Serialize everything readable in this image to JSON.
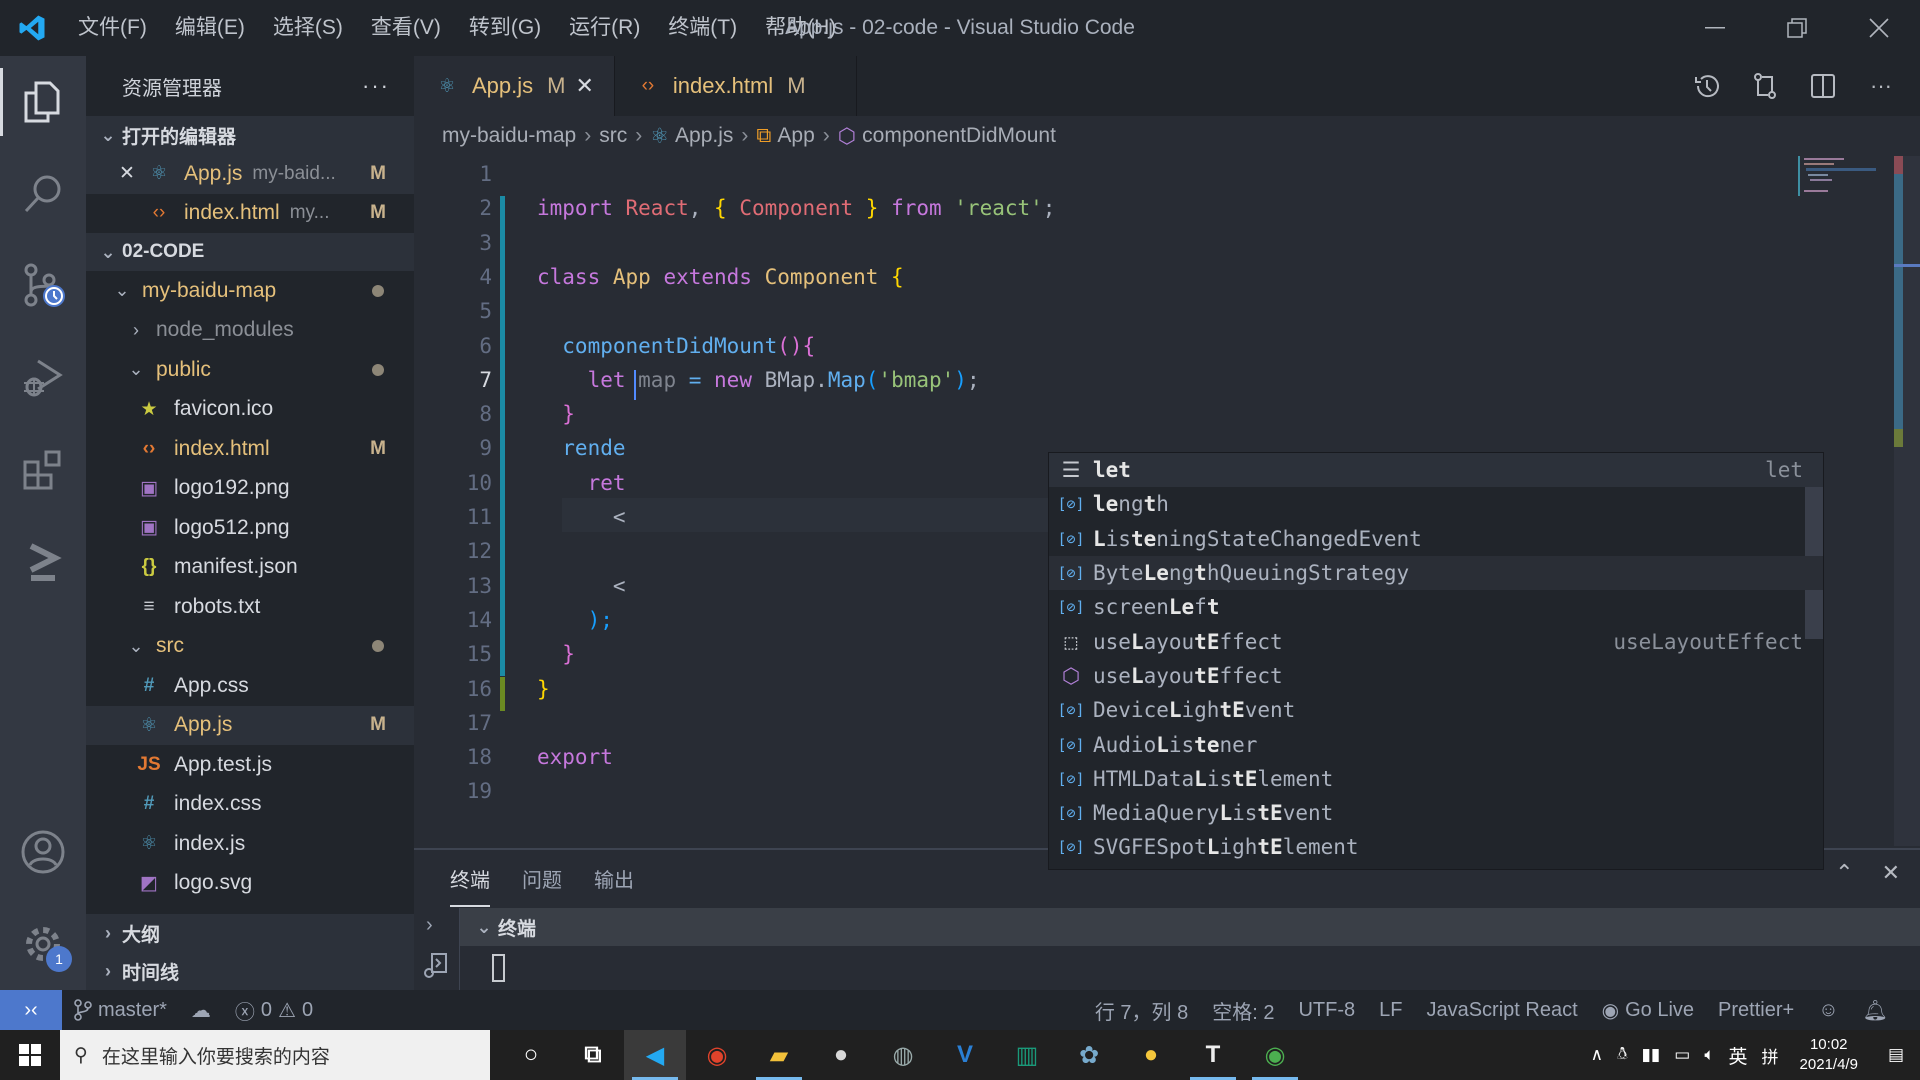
{
  "window": {
    "title": "App.js - 02-code - Visual Studio Code"
  },
  "menu": [
    "文件(F)",
    "编辑(E)",
    "选择(S)",
    "查看(V)",
    "转到(G)",
    "运行(R)",
    "终端(T)",
    "帮助(H)"
  ],
  "activity_bar": {
    "items": [
      "explorer",
      "search",
      "source-control",
      "run-debug",
      "extensions",
      "live-share"
    ],
    "settings_badge": "1"
  },
  "sidebar": {
    "title": "资源管理器",
    "open_editors": {
      "header": "打开的编辑器",
      "items": [
        {
          "name": "App.js",
          "desc": "my-baid...",
          "status": "M"
        },
        {
          "name": "index.html",
          "desc": "my...",
          "status": "M"
        }
      ]
    },
    "workspace": {
      "header": "02-CODE",
      "tree": [
        {
          "name": "my-baidu-map",
          "type": "folder-open",
          "indent": 1,
          "dot": true
        },
        {
          "name": "node_modules",
          "type": "folder-closed",
          "indent": 2
        },
        {
          "name": "public",
          "type": "folder-open",
          "indent": 2,
          "dot": true
        },
        {
          "name": "favicon.ico",
          "type": "file-ico",
          "indent": 3
        },
        {
          "name": "index.html",
          "type": "file-html",
          "indent": 3,
          "status": "M"
        },
        {
          "name": "logo192.png",
          "type": "file-img",
          "indent": 3
        },
        {
          "name": "logo512.png",
          "type": "file-img",
          "indent": 3
        },
        {
          "name": "manifest.json",
          "type": "file-json",
          "indent": 3
        },
        {
          "name": "robots.txt",
          "type": "file-txt",
          "indent": 3
        },
        {
          "name": "src",
          "type": "folder-open",
          "indent": 2,
          "dot": true
        },
        {
          "name": "App.css",
          "type": "file-css",
          "indent": 3
        },
        {
          "name": "App.js",
          "type": "file-react",
          "indent": 3,
          "status": "M",
          "selected": true
        },
        {
          "name": "App.test.js",
          "type": "file-js",
          "indent": 3
        },
        {
          "name": "index.css",
          "type": "file-css",
          "indent": 3
        },
        {
          "name": "index.js",
          "type": "file-react",
          "indent": 3
        },
        {
          "name": "logo.svg",
          "type": "file-svg",
          "indent": 3
        }
      ]
    },
    "outline": "大纲",
    "timeline": "时间线"
  },
  "tabs": [
    {
      "name": "App.js",
      "status": "M",
      "active": true
    },
    {
      "name": "index.html",
      "status": "M",
      "active": false
    }
  ],
  "breadcrumb": [
    "my-baidu-map",
    "src",
    "App.js",
    "App",
    "componentDidMount"
  ],
  "code": {
    "current_line": 7,
    "lines": [
      [],
      [
        [
          "import ",
          "k"
        ],
        [
          "React",
          "r"
        ],
        [
          ", ",
          "p"
        ],
        [
          "{",
          "b1"
        ],
        [
          " Component ",
          "r"
        ],
        [
          "}",
          "b1"
        ],
        [
          " from ",
          "k"
        ],
        [
          "'react'",
          "s"
        ],
        [
          ";",
          "p"
        ]
      ],
      [],
      [
        [
          "class ",
          "k"
        ],
        [
          "App ",
          "y"
        ],
        [
          "extends ",
          "k"
        ],
        [
          "Component ",
          "y"
        ],
        [
          "{",
          "b1"
        ]
      ],
      [],
      [
        [
          "  componentDidMount",
          "f"
        ],
        [
          "()",
          "b2"
        ],
        [
          "{",
          "b2"
        ]
      ],
      [
        [
          "    let",
          "k"
        ],
        [
          " map",
          "dim"
        ],
        [
          " = ",
          "f"
        ],
        [
          "new ",
          "k"
        ],
        [
          "BMap.",
          "p"
        ],
        [
          "Map",
          "f"
        ],
        [
          "(",
          "b3"
        ],
        [
          "'bmap'",
          "s"
        ],
        [
          ")",
          "b3"
        ],
        [
          ";",
          "p"
        ]
      ],
      [
        [
          "  }",
          "b2"
        ]
      ],
      [
        [
          "  rende",
          "f"
        ]
      ],
      [
        [
          "    ret",
          "k"
        ]
      ],
      [
        [
          "      <",
          "p"
        ]
      ],
      [],
      [
        [
          "      <",
          "p"
        ]
      ],
      [
        [
          "    );",
          "b3"
        ]
      ],
      [
        [
          "  }",
          "b2"
        ]
      ],
      [
        [
          "}",
          "b1"
        ]
      ],
      [],
      [
        [
          "export",
          "k"
        ]
      ],
      []
    ]
  },
  "suggestions": [
    {
      "icon": "keyword",
      "parts": [
        [
          "let",
          1
        ]
      ],
      "detail": "let"
    },
    {
      "icon": "variable",
      "parts": [
        [
          "le",
          1
        ],
        [
          "ng",
          0
        ],
        [
          "t",
          1
        ],
        [
          "h",
          0
        ]
      ]
    },
    {
      "icon": "variable",
      "parts": [
        [
          "L",
          1
        ],
        [
          "is",
          0
        ],
        [
          "te",
          1
        ],
        [
          "ningStateChangedEvent",
          0
        ]
      ]
    },
    {
      "icon": "variable",
      "parts": [
        [
          "Byte",
          0
        ],
        [
          "Le",
          1
        ],
        [
          "ng",
          0
        ],
        [
          "t",
          1
        ],
        [
          "hQueuingStrategy",
          0
        ]
      ]
    },
    {
      "icon": "variable",
      "parts": [
        [
          "screen",
          0
        ],
        [
          "Le",
          1
        ],
        [
          "f",
          0
        ],
        [
          "t",
          1
        ]
      ]
    },
    {
      "icon": "snippet",
      "parts": [
        [
          "use",
          0
        ],
        [
          "L",
          1
        ],
        [
          "ayou",
          0
        ],
        [
          "tE",
          1
        ],
        [
          "ffect",
          0
        ]
      ],
      "detail": "useLayoutEffect"
    },
    {
      "icon": "method",
      "parts": [
        [
          "use",
          0
        ],
        [
          "L",
          1
        ],
        [
          "ayou",
          0
        ],
        [
          "tE",
          1
        ],
        [
          "ffect",
          0
        ]
      ]
    },
    {
      "icon": "variable",
      "parts": [
        [
          "Device",
          0
        ],
        [
          "L",
          1
        ],
        [
          "igh",
          0
        ],
        [
          "tE",
          1
        ],
        [
          "vent",
          0
        ]
      ]
    },
    {
      "icon": "variable",
      "parts": [
        [
          "Audio",
          0
        ],
        [
          "L",
          1
        ],
        [
          "is",
          0
        ],
        [
          "te",
          1
        ],
        [
          "ner",
          0
        ]
      ]
    },
    {
      "icon": "variable",
      "parts": [
        [
          "HTMLData",
          0
        ],
        [
          "L",
          1
        ],
        [
          "is",
          0
        ],
        [
          "tE",
          1
        ],
        [
          "lement",
          0
        ]
      ]
    },
    {
      "icon": "variable",
      "parts": [
        [
          "MediaQuery",
          0
        ],
        [
          "L",
          1
        ],
        [
          "is",
          0
        ],
        [
          "tE",
          1
        ],
        [
          "vent",
          0
        ]
      ]
    },
    {
      "icon": "variable",
      "parts": [
        [
          "SVGFESpot",
          0
        ],
        [
          "L",
          1
        ],
        [
          "igh",
          0
        ],
        [
          "tE",
          1
        ],
        [
          "lement",
          0
        ]
      ]
    }
  ],
  "panel": {
    "tabs": [
      "终端",
      "问题",
      "输出"
    ],
    "active_tab": "终端",
    "terminal_header": "终端"
  },
  "statusbar": {
    "branch": "master*",
    "errors": "0",
    "warnings": "0",
    "position": "行 7，列 8",
    "indent": "空格: 2",
    "encoding": "UTF-8",
    "eol": "LF",
    "language": "JavaScript React",
    "golive": "Go Live",
    "prettier": "Prettier+"
  },
  "taskbar": {
    "search_placeholder": "在这里输入你要搜索的内容",
    "apps": [
      "cortana",
      "task-view",
      "vscode",
      "app-swirl",
      "file-explorer",
      "wechat",
      "remote-app",
      "visual-studio",
      "app-green",
      "app-pinwheel",
      "app-bubbles",
      "typora",
      "chrome"
    ],
    "ime": "英",
    "time": "10:02",
    "date": "2021/4/9"
  },
  "colors": {
    "accent": "#4d78cc",
    "modified": "#e5c07b",
    "keyword": "#c678dd",
    "string": "#98c379",
    "function": "#61afef"
  }
}
